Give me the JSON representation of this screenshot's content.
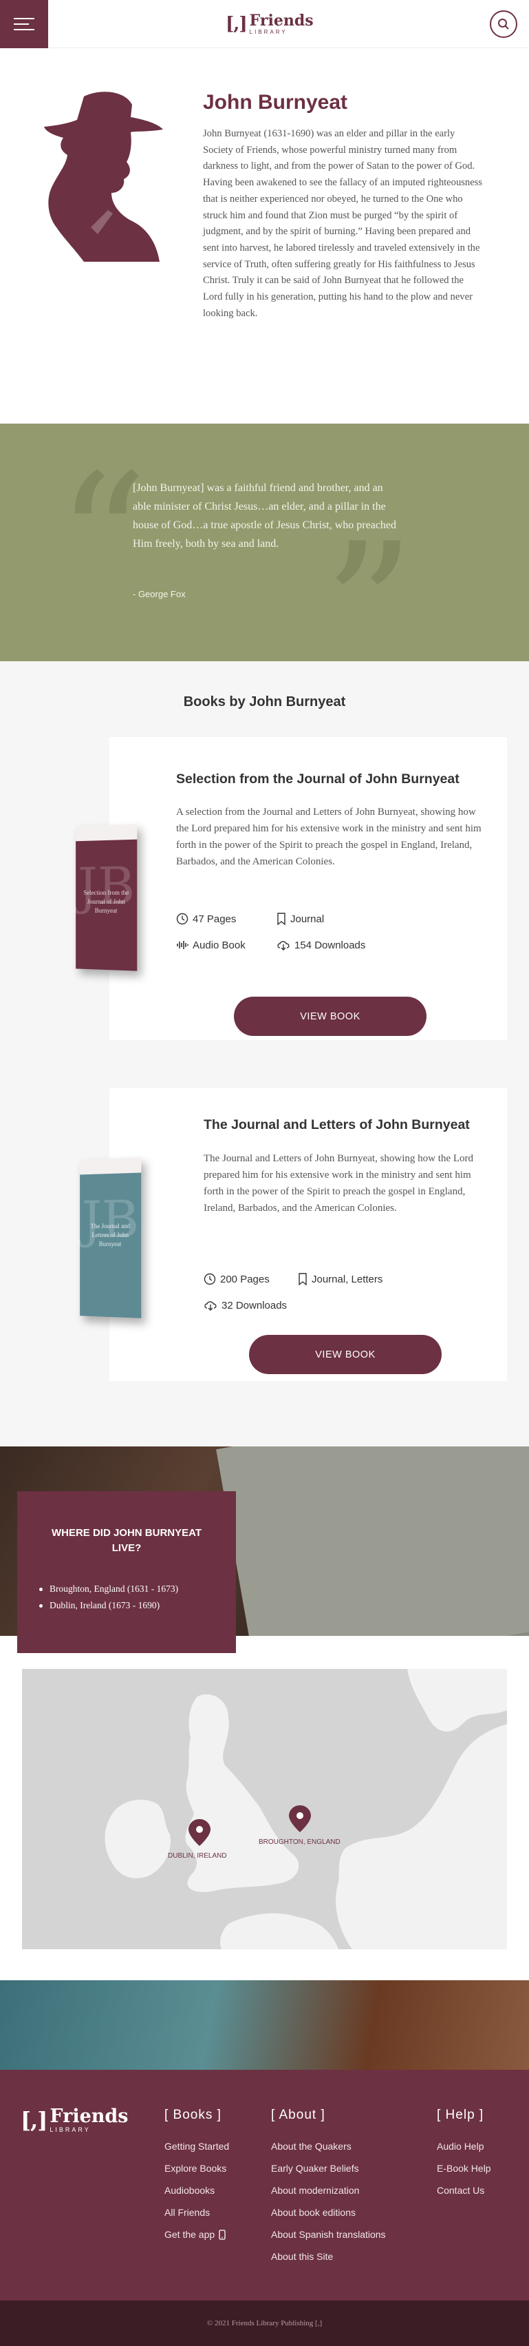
{
  "header": {
    "logo_mark": "[,]",
    "logo_name": "Friends",
    "logo_sub": "LIBRARY"
  },
  "author": {
    "name": "John Burnyeat",
    "bio": "John Burnyeat (1631-1690) was an elder and pillar in the early Society of Friends, whose powerful ministry turned many from darkness to light, and from the power of Satan to the power of God. Having been awakened to see the fallacy of an imputed righteousness that is neither experienced nor obeyed, he turned to the One who struck him and found that Zion must be purged “by the spirit of judgment, and by the spirit of burning.” Having been prepared and sent into harvest, he labored tirelessly and traveled extensively in the service of Truth, often suffering greatly for His faithfulness to Jesus Christ. Truly it can be said of John Burnyeat that he followed the Lord fully in his generation, putting his hand to the plow and never looking back."
  },
  "quote": {
    "text": "[John Burnyeat] was a faithful friend and brother, and an able minister of Christ Jesus…an elder, and a pillar in the house of God…a true apostle of Jesus Christ, who preached Him freely, both by sea and land.",
    "cite": "- George Fox"
  },
  "books": {
    "heading": "Books by John Burnyeat",
    "items": [
      {
        "title": "Selection from the Journal of John Burnyeat",
        "description": "A selection from the Journal and Letters of John Burnyeat, showing how the Lord prepared him for his extensive work in the ministry and sent him forth in the power of the Spirit to preach the gospel in England, Ireland, Barbados, and the American Colonies.",
        "cover_title": "Selection from the Journal of John Burnyeat",
        "cover_letters": "JB",
        "pages": "47 Pages",
        "type": "Journal",
        "audio": "Audio Book",
        "downloads": "154 Downloads",
        "button": "VIEW BOOK"
      },
      {
        "title": "The Journal and Letters of John Burnyeat",
        "description": "The Journal and Letters of John Burnyeat, showing how the Lord prepared him for his extensive work in the ministry and sent him forth in the power of the Spirit to preach the gospel in England, Ireland, Barbados, and the American Colonies.",
        "cover_title": "The Journal and Letters of John Burnyeat",
        "cover_letters": "JB",
        "pages": "200 Pages",
        "type": "Journal, Letters",
        "downloads": "32 Downloads",
        "button": "VIEW BOOK"
      }
    ]
  },
  "residences": {
    "heading": "WHERE DID JOHN BURNYEAT LIVE?",
    "items": [
      "Broughton, England (1631 - 1673)",
      "Dublin, Ireland (1673 - 1690)"
    ],
    "map_pins": [
      {
        "label": "DUBLIN, IRELAND"
      },
      {
        "label": "BROUGHTON, ENGLAND"
      }
    ]
  },
  "footer": {
    "logo_mark": "[,]",
    "logo_name": "Friends",
    "logo_sub": "LIBRARY",
    "books_title": "[ Books ]",
    "books_links": [
      "Getting Started",
      "Explore Books",
      "Audiobooks",
      "All Friends",
      "Get the app"
    ],
    "about_title": "[ About ]",
    "about_links": [
      "About the Quakers",
      "Early Quaker Beliefs",
      "About modernization",
      "About book editions",
      "About Spanish translations",
      "About this Site"
    ],
    "help_title": "[ Help ]",
    "help_links": [
      "Audio Help",
      "E-Book Help",
      "Contact Us"
    ],
    "copyright": "© 2021 Friends Library Publishing [,]"
  },
  "colors": {
    "brand": "#6c3142",
    "quote_bg": "#939a6d",
    "footer_bottom": "#3c1d26"
  }
}
